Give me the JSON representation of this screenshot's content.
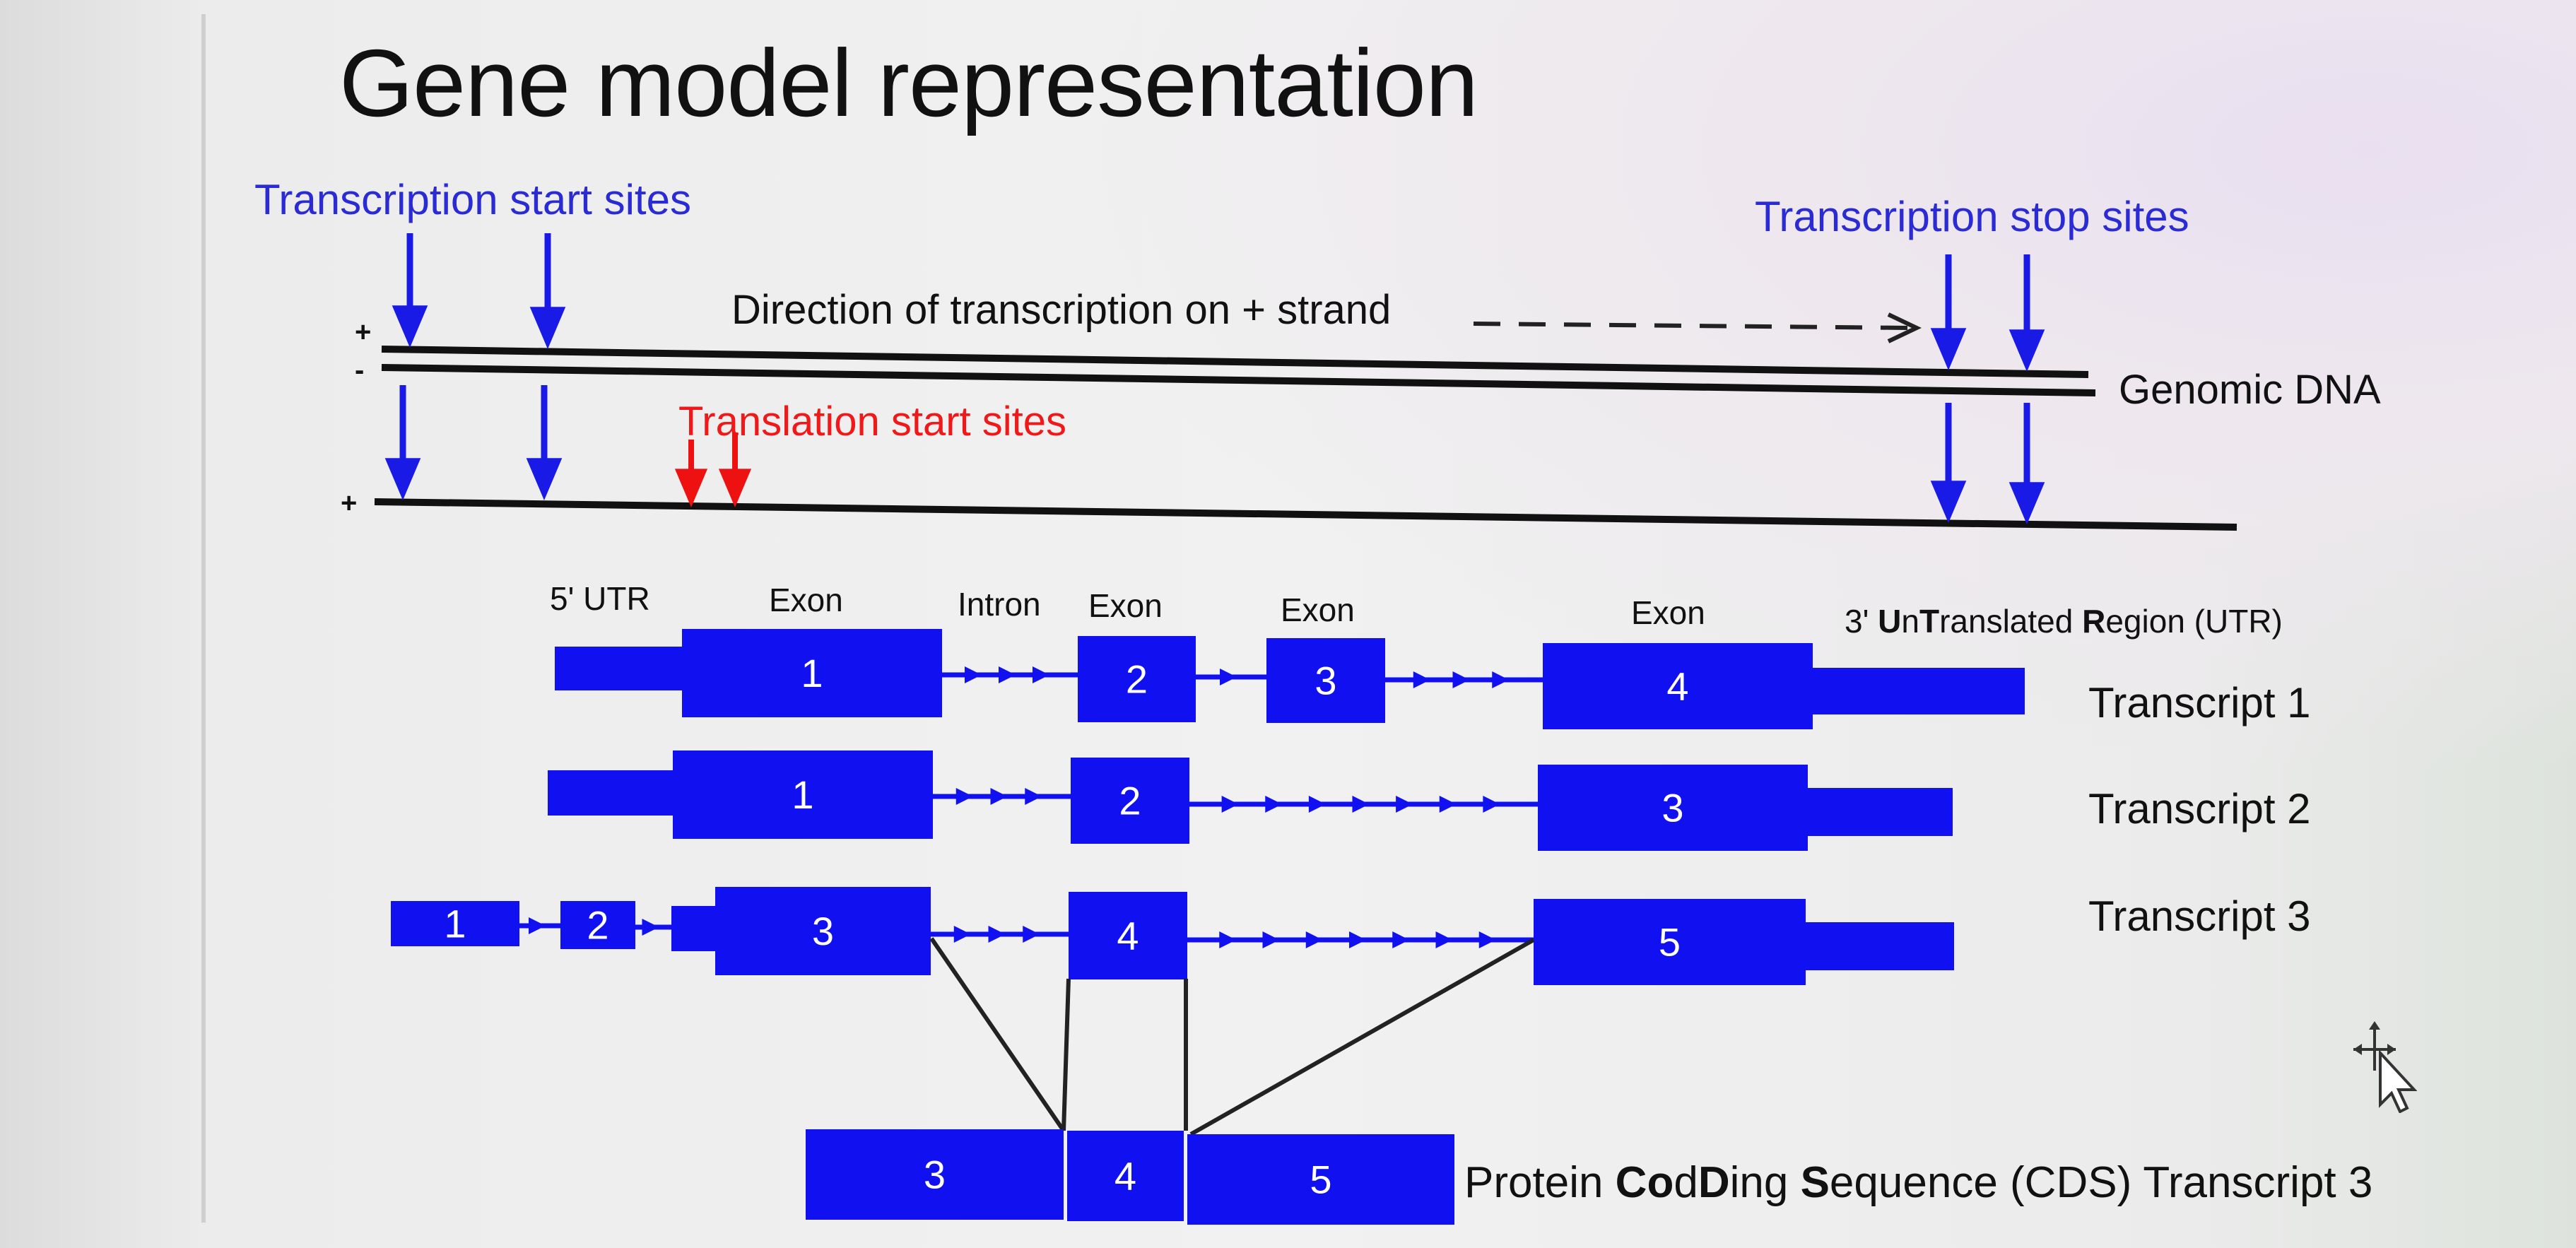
{
  "title": "Gene model representation",
  "labels": {
    "tss": "Transcription start sites",
    "stop": "Transcription stop sites",
    "direction": "Direction of transcription on + strand",
    "genomic_dna": "Genomic DNA",
    "translation_start": "Translation start sites",
    "strand_plus": "+",
    "strand_minus": "-",
    "utr5": "5' UTR",
    "exon": "Exon",
    "intron": "Intron",
    "utr3_pre": "3' ",
    "utr3_U": "U",
    "utr3_n": "n",
    "utr3_T": "T",
    "utr3_ranslated": "ranslated ",
    "utr3_R": "R",
    "utr3_egion": "egion (UTR)",
    "cds_pre": "Protein ",
    "cds_Co": "Co",
    "cds_D": "D",
    "cds_ing": "ing ",
    "cds_S": "S",
    "cds_post": "equence (CDS) Transcript 3"
  },
  "transcripts": [
    {
      "name": "Transcript 1",
      "exons": [
        "1",
        "2",
        "3",
        "4"
      ]
    },
    {
      "name": "Transcript 2",
      "exons": [
        "1",
        "2",
        "3"
      ]
    },
    {
      "name": "Transcript 3",
      "exons": [
        "1",
        "2",
        "3",
        "4",
        "5"
      ]
    }
  ],
  "cds": {
    "exons": [
      "3",
      "4",
      "5"
    ]
  },
  "colors": {
    "feature": "#1010f0",
    "arrow_blue": "#1a1ae6",
    "arrow_red": "#ee1111",
    "label_blue": "#2b2bd6"
  }
}
